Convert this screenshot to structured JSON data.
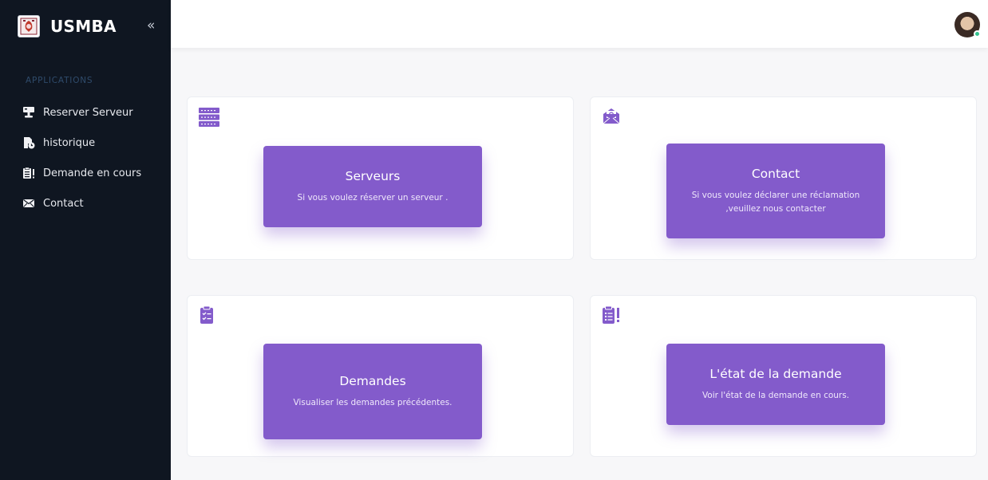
{
  "sidebar": {
    "brand": "USMBA",
    "collapse_label": "«",
    "section_title": "APPLICATIONS",
    "items": [
      {
        "label": "Reserver Serveur",
        "icon": "server-tower-icon"
      },
      {
        "label": "historique",
        "icon": "document-clock-icon"
      },
      {
        "label": "Demande en cours",
        "icon": "clipboard-list-icon"
      },
      {
        "label": "Contact",
        "icon": "envelope-icon"
      }
    ]
  },
  "topbar": {
    "avatar_status_color": "#34c38f"
  },
  "cards": [
    {
      "icon": "server-rack-icon",
      "title": "Serveurs",
      "description": "Si vous voulez réserver un serveur ."
    },
    {
      "icon": "envelope-at-icon",
      "title": "Contact",
      "description": "Si vous voulez déclarer une réclamation ,veuillez nous contacter"
    },
    {
      "icon": "clipboard-check-icon",
      "title": "Demandes",
      "description": "Visualiser les demandes précédentes."
    },
    {
      "icon": "clipboard-list-icon",
      "title": "L'état de la demande",
      "description": "Voir l'état de la demande en cours."
    }
  ],
  "colors": {
    "sidebar_bg": "#0f1621",
    "accent": "#835bcb",
    "page_bg": "#f7f7f9"
  }
}
